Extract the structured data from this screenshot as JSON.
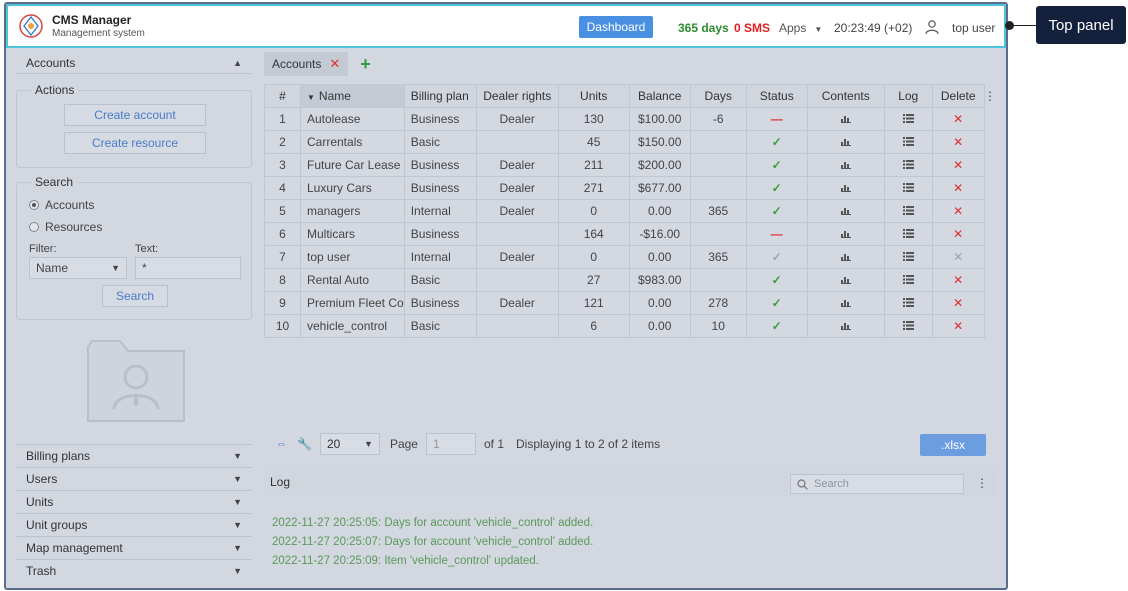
{
  "topbar": {
    "title": "CMS Manager",
    "subtitle": "Management system",
    "dashboard_label": "Dashboard",
    "days": "365 days",
    "sms": "0 SMS",
    "apps_label": "Apps",
    "time": "20:23:49 (+02)",
    "user": "top user"
  },
  "sidebar": {
    "accounts_header": "Accounts",
    "actions_title": "Actions",
    "create_account": "Create account",
    "create_resource": "Create resource",
    "search_title": "Search",
    "radio_accounts": "Accounts",
    "radio_resources": "Resources",
    "filter_label": "Filter:",
    "filter_value": "Name",
    "text_label": "Text:",
    "text_value": "*",
    "search_button": "Search",
    "items": [
      "Billing plans",
      "Users",
      "Units",
      "Unit groups",
      "Map management",
      "Trash"
    ]
  },
  "tabs": {
    "active": "Accounts"
  },
  "table": {
    "headers": [
      "#",
      "Name",
      "Billing plan",
      "Dealer rights",
      "Units",
      "Balance",
      "Days",
      "Status",
      "Contents",
      "Log",
      "Delete"
    ],
    "rows": [
      {
        "n": "1",
        "name": "Autolease",
        "plan": "Business",
        "dealer": "Dealer",
        "units": "130",
        "balance": "$100.00",
        "days": "-6",
        "status": "blocked",
        "dim": false
      },
      {
        "n": "2",
        "name": "Carrentals",
        "plan": "Basic",
        "dealer": "",
        "units": "45",
        "balance": "$150.00",
        "days": "",
        "status": "ok",
        "dim": false
      },
      {
        "n": "3",
        "name": "Future Car Lease",
        "plan": "Business",
        "dealer": "Dealer",
        "units": "211",
        "balance": "$200.00",
        "days": "",
        "status": "ok",
        "dim": false
      },
      {
        "n": "4",
        "name": "Luxury Cars",
        "plan": "Business",
        "dealer": "Dealer",
        "units": "271",
        "balance": "$677.00",
        "days": "",
        "status": "ok",
        "dim": false
      },
      {
        "n": "5",
        "name": "managers",
        "plan": "Internal",
        "dealer": "Dealer",
        "units": "0",
        "balance": "0.00",
        "days": "365",
        "status": "ok",
        "dim": false
      },
      {
        "n": "6",
        "name": "Multicars",
        "plan": "Business",
        "dealer": "",
        "units": "164",
        "balance": "-$16.00",
        "days": "",
        "status": "blocked",
        "dim": false
      },
      {
        "n": "7",
        "name": "top user",
        "plan": "Internal",
        "dealer": "Dealer",
        "units": "0",
        "balance": "0.00",
        "days": "365",
        "status": "ok",
        "dim": true
      },
      {
        "n": "8",
        "name": "Rental Auto",
        "plan": "Basic",
        "dealer": "",
        "units": "27",
        "balance": "$983.00",
        "days": "",
        "status": "ok",
        "dim": false
      },
      {
        "n": "9",
        "name": "Premium Fleet Co",
        "plan": "Business",
        "dealer": "Dealer",
        "units": "121",
        "balance": "0.00",
        "days": "278",
        "status": "ok",
        "dim": false
      },
      {
        "n": "10",
        "name": "vehicle_control",
        "plan": "Basic",
        "dealer": "",
        "units": "6",
        "balance": "0.00",
        "days": "10",
        "status": "ok",
        "dim": false
      }
    ]
  },
  "pager": {
    "page_size": "20",
    "page_label": "Page",
    "page_value": "1",
    "of_label": "of 1",
    "display_text": "Displaying 1 to 2 of 2 items",
    "export_label": ".xlsx"
  },
  "log": {
    "title": "Log",
    "search_placeholder": "Search",
    "lines": [
      "2022-11-27 20:25:05: Days for account 'vehicle_control' added.",
      "2022-11-27 20:25:07: Days for account 'vehicle_control' added.",
      "2022-11-27 20:25:09: Item 'vehicle_control' updated."
    ]
  },
  "callout": {
    "label": "Top panel"
  },
  "colors": {
    "accent": "#4a90e2",
    "ok": "#3a9d3a",
    "bad": "#e03030",
    "callout_bg": "#14213d"
  }
}
